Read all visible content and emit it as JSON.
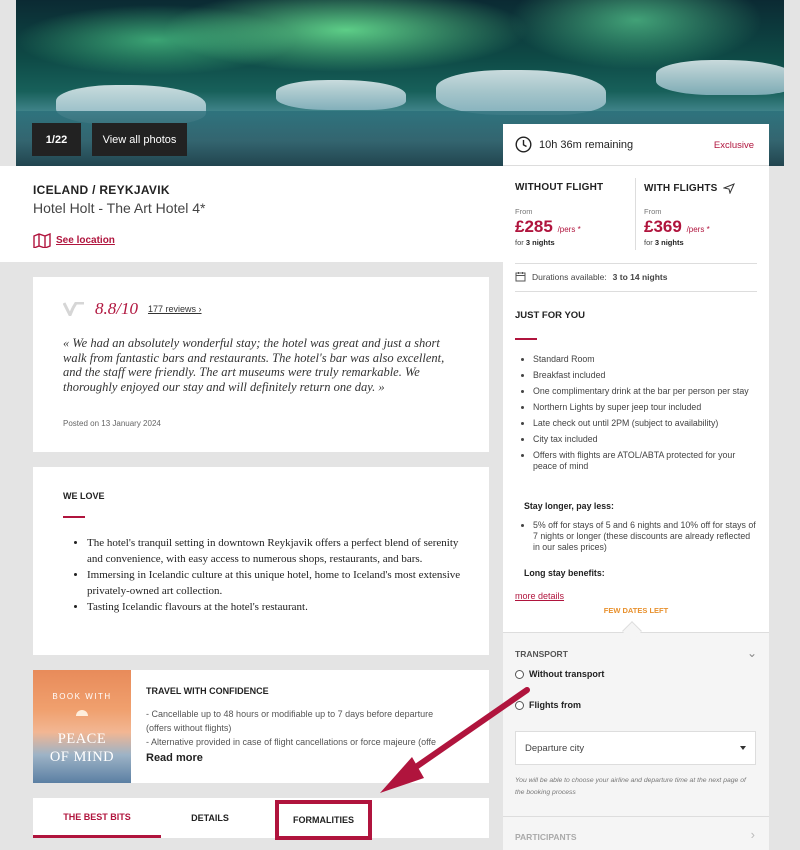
{
  "gallery": {
    "counter": "1/22",
    "view_all": "View all photos"
  },
  "hotel": {
    "destination": "ICELAND / REYKJAVIK",
    "name": "Hotel Holt - The Art Hotel 4*",
    "see_location": "See location"
  },
  "review": {
    "score": "8.8/10",
    "reviews_link": "177 reviews",
    "quote": "« We had an absolutely wonderful stay; the hotel was great and just a short walk from fantastic bars and restaurants. The hotel's bar was also excellent, and the staff were friendly. The art museums were truly remarkable. We thoroughly enjoyed our stay and will definitely return one day. »",
    "posted": "Posted on 13 January 2024"
  },
  "we_love": {
    "title": "WE LOVE",
    "items": [
      "The hotel's tranquil setting in downtown Reykjavik offers a perfect blend of serenity and convenience, with easy access to numerous shops, restaurants, and bars.",
      "Immersing in Icelandic culture at this unique hotel, home to Iceland's most extensive privately-owned art collection.",
      "Tasting Icelandic flavours at the hotel's restaurant."
    ]
  },
  "confidence": {
    "image_small": "BOOK WITH",
    "image_big_1": "PEACE",
    "image_big_2": "OF MIND",
    "title": "TRAVEL WITH CONFIDENCE",
    "line1": "- Cancellable up to 48 hours or modifiable up to 7 days before departure",
    "line2": "(offers without flights)",
    "line3": "- Alternative provided in case of flight cancellations or force majeure (offe",
    "read_more": "Read more"
  },
  "tabs": {
    "best_bits": "THE BEST BITS",
    "details": "DETAILS",
    "formalities": "FORMALITIES"
  },
  "sidebar": {
    "timer": "10h 36m remaining",
    "exclusive": "Exclusive",
    "without_flight": {
      "label": "WITHOUT FLIGHT",
      "from": "From",
      "price": "£285",
      "pers": "/pers *",
      "for": "for",
      "nights": "3 nights"
    },
    "with_flights": {
      "label": "WITH FLIGHTS",
      "from": "From",
      "price": "£369",
      "pers": "/pers *",
      "for": "for",
      "nights": "3 nights"
    },
    "durations_label": "Durations available:",
    "durations_value": "3 to 14 nights",
    "just_for_you": "JUST FOR YOU",
    "perks": [
      "Standard Room",
      "Breakfast included",
      "One complimentary drink at the bar per person per stay",
      "Northern Lights by super jeep tour included",
      "Late check out until 2PM (subject to availability)",
      "City tax included",
      "Offers with flights are ATOL/ABTA protected for your peace of mind"
    ],
    "stay_longer": "Stay longer, pay less:",
    "stay_longer_items": [
      "5% off for stays of 5 and 6 nights and 10% off for stays of 7 nights or longer (these discounts are already reflected in our sales prices)"
    ],
    "long_stay": "Long stay benefits:",
    "more_details": "more details",
    "few_dates": "FEW DATES LEFT",
    "transport": {
      "title": "TRANSPORT",
      "option_without": "Without transport",
      "option_flights": "Flights from",
      "departure_placeholder": "Departure city",
      "note": "You will be able to choose your airline and departure time at the next page of the booking process"
    },
    "participants": "PARTICIPANTS"
  },
  "colors": {
    "accent": "#b0143d",
    "orange": "#e8912e",
    "background": "#e4e4e4"
  }
}
